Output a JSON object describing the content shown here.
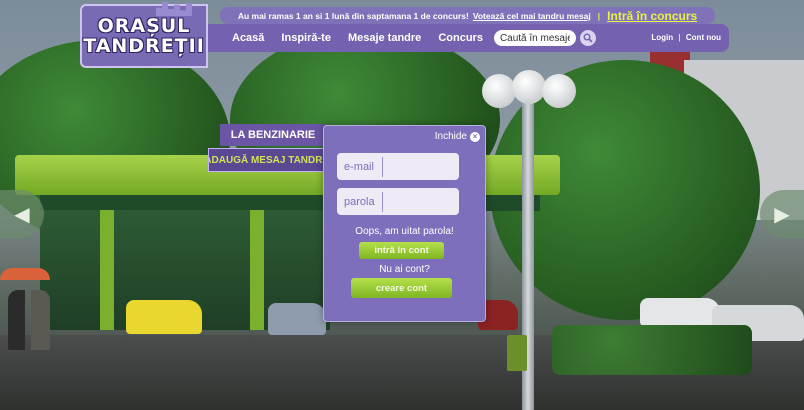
{
  "header": {
    "logo_line1": "ORAȘUL",
    "logo_line2": "TANDREȚII",
    "announcement": "Au mai ramas 1 an si 1 lună din saptamana 1 de concurs!",
    "vote_link": "Votează cel mai tandru mesaj",
    "separator": "|",
    "contest_link": "Intră în concurs",
    "nav": [
      "Acasă",
      "Inspiră-te",
      "Mesaje tandre",
      "Concurs"
    ],
    "search_placeholder": "Caută în mesaje",
    "login": "Login",
    "auth_separator": "|",
    "register": "Cont nou"
  },
  "scene": {
    "sign_top": "LA BENZINARIE",
    "sign_bottom": "ADAUGĂ MESAJ TANDRU",
    "arrow_left": "◀",
    "arrow_right": "▶"
  },
  "modal": {
    "close_label": "Inchide",
    "close_icon": "×",
    "email_placeholder": "e-mail",
    "password_placeholder": "parola",
    "forgot": "Oops, am uitat parola!",
    "login_button": "intră în cont",
    "no_account": "Nu ai cont?",
    "create_button": "creare cont"
  },
  "colors": {
    "brand_purple": "#7461b0",
    "accent_yellow": "#e8f24a",
    "button_green": "#8fc230"
  }
}
